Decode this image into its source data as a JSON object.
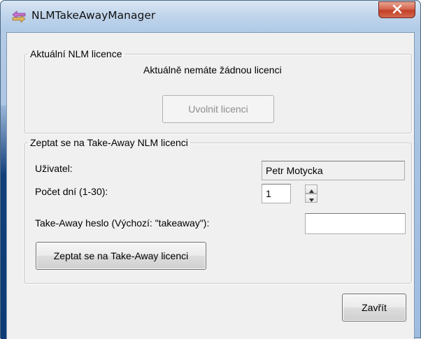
{
  "window": {
    "title": "NLMTakeAwayManager",
    "close_label": "x"
  },
  "current_license": {
    "legend": "Aktuální NLM licence",
    "status_text": "Aktuálně nemáte žádnou licenci",
    "release_button": "Uvolnit licenci"
  },
  "takeaway_request": {
    "legend": "Zeptat se na Take-Away NLM licenci",
    "user_label": "Uživatel:",
    "user_value": "Petr Motycka",
    "days_label": "Počet dní (1-30):",
    "days_value": "1",
    "password_label": "Take-Away heslo (Výchozí: \"takeaway\"):",
    "password_value": "",
    "request_button": "Zeptat se na Take-Away licenci"
  },
  "footer": {
    "close_button": "Zavřít"
  },
  "colors": {
    "titlebar": "#c2d6ec",
    "close_button": "#c24127",
    "dialog_face": "#f0f0f0",
    "disabled_text": "#8d8d8d"
  },
  "icons": {
    "app": "arrow-swap-icon",
    "close": "close-icon",
    "spin_up": "triangle-up-icon",
    "spin_down": "triangle-down-icon"
  }
}
